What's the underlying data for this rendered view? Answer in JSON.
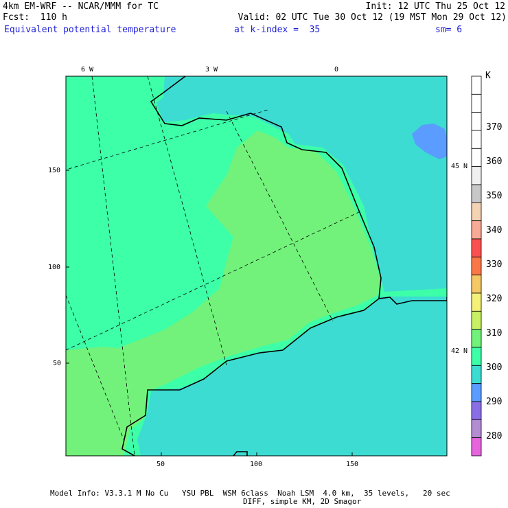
{
  "header": {
    "line1_left": "4km EM-WRF -- NCAR/MMM for TC",
    "line1_right": "Init: 12 UTC Thu 25 Oct 12",
    "line2_left": "Fcst:  110 h",
    "line2_right": "Valid: 02 UTC Tue 30 Oct 12 (19 MST Mon 29 Oct 12)",
    "field_name": "Equivalent potential temperature",
    "level": "at k-index =  35",
    "smoothing": "sm= 6"
  },
  "map": {
    "top_lon_labels": [
      "6 W",
      "3 W",
      "0"
    ],
    "right_lat_labels": [
      "45 N",
      "42 N"
    ],
    "x_ticks": [
      "50",
      "100",
      "150"
    ],
    "y_ticks": [
      "150",
      "100",
      "50"
    ],
    "colors": {
      "dominant": "#3cffa8",
      "warm": "#72f27a",
      "cool": "#3cdcd2",
      "cold": "#5a9cff"
    }
  },
  "colorbar": {
    "unit": "K",
    "labels": [
      "370",
      "360",
      "350",
      "340",
      "330",
      "320",
      "310",
      "300",
      "290",
      "280"
    ],
    "colors": [
      "#ffffff",
      "#ffffff",
      "#ffffff",
      "#ffffff",
      "#ffffff",
      "#f0f0f0",
      "#c8c8c8",
      "#f4d2b4",
      "#f8aa96",
      "#fa5050",
      "#fa7848",
      "#f4c864",
      "#f4f078",
      "#c8f064",
      "#72f27a",
      "#3cffa8",
      "#3cdcd2",
      "#5a9cff",
      "#8a6ee6",
      "#b48cd2",
      "#e664dc"
    ]
  },
  "footer": {
    "line1": "Model Info: V3.3.1 M No Cu   YSU PBL  WSM 6class  Noah LSM  4.0 km,  35 levels,   20 sec",
    "line2": "DIFF, simple KM, 2D Smagor"
  }
}
